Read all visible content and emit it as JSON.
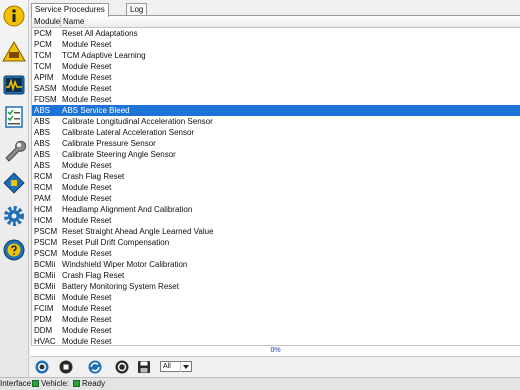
{
  "tabs": [
    {
      "label": "Service Procedures",
      "active": true
    },
    {
      "label": "Log",
      "active": false
    }
  ],
  "table": {
    "columns": [
      "Module",
      "Name"
    ],
    "selected_index": 7,
    "rows": [
      {
        "module": "PCM",
        "name": "Reset All Adaptations"
      },
      {
        "module": "PCM",
        "name": "Module Reset"
      },
      {
        "module": "TCM",
        "name": "TCM Adaptive Learning"
      },
      {
        "module": "TCM",
        "name": "Module Reset"
      },
      {
        "module": "APIM",
        "name": "Module Reset"
      },
      {
        "module": "SASM",
        "name": "Module Reset"
      },
      {
        "module": "FDSM",
        "name": "Module Reset"
      },
      {
        "module": "ABS",
        "name": "ABS Service Bleed"
      },
      {
        "module": "ABS",
        "name": "Calibrate Longitudinal Acceleration Sensor"
      },
      {
        "module": "ABS",
        "name": "Calibrate Lateral Acceleration Sensor"
      },
      {
        "module": "ABS",
        "name": "Calibrate Pressure Sensor"
      },
      {
        "module": "ABS",
        "name": "Calibrate Steering Angle Sensor"
      },
      {
        "module": "ABS",
        "name": "Module Reset"
      },
      {
        "module": "RCM",
        "name": "Crash Flag Reset"
      },
      {
        "module": "RCM",
        "name": "Module Reset"
      },
      {
        "module": "PAM",
        "name": "Module Reset"
      },
      {
        "module": "HCM",
        "name": "Headlamp Alignment And Calibration"
      },
      {
        "module": "HCM",
        "name": "Module Reset"
      },
      {
        "module": "PSCM",
        "name": "Reset Straight Ahead Angle Learned Value"
      },
      {
        "module": "PSCM",
        "name": "Reset Pull Drift Compensation"
      },
      {
        "module": "PSCM",
        "name": "Module Reset"
      },
      {
        "module": "BCMii",
        "name": "Windshield Wiper Motor Calibration"
      },
      {
        "module": "BCMii",
        "name": "Crash Flag Reset"
      },
      {
        "module": "BCMii",
        "name": "Battery Monitoring System Reset"
      },
      {
        "module": "BCMii",
        "name": "Module Reset"
      },
      {
        "module": "FCIM",
        "name": "Module Reset"
      },
      {
        "module": "PDM",
        "name": "Module Reset"
      },
      {
        "module": "DDM",
        "name": "Module Reset"
      },
      {
        "module": "HVAC",
        "name": "Module Reset"
      }
    ]
  },
  "progress": {
    "value": 0,
    "text": "0%"
  },
  "toolbar": {
    "filter_value": "All"
  },
  "status": {
    "interface_label": "Interface:",
    "vehicle_label": "Vehicle:",
    "state_text": "Ready"
  },
  "colors": {
    "selection": "#1e73d6",
    "status_green": "#2f9e3f",
    "info_yellow": "#f2c200",
    "progress_text": "#1a3fb0"
  },
  "sidebar_icons": [
    "info-icon",
    "dtc-warning-icon",
    "oscilloscope-icon",
    "checklist-icon",
    "wrench-icon",
    "chip-icon",
    "gear-icon",
    "help-icon"
  ],
  "toolbar_icons": [
    "play-icon",
    "stop-icon",
    "refresh-icon",
    "record-icon",
    "save-icon"
  ]
}
